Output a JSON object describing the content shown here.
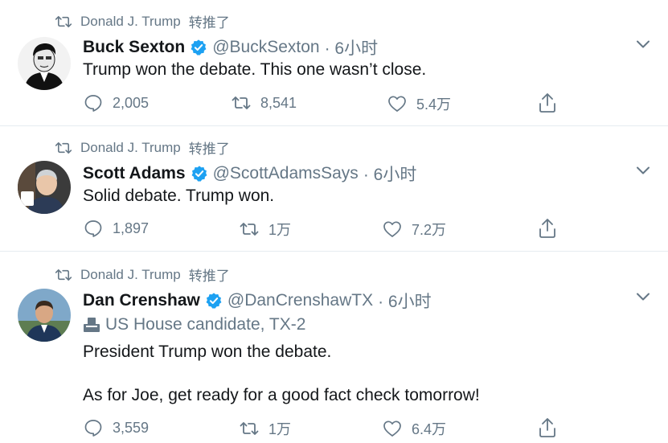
{
  "tweets": [
    {
      "retweeter": "Donald J. Trump",
      "retweet_label": "转推了",
      "name": "Buck Sexton",
      "handle": "@BuckSexton",
      "time": "· 6小时",
      "text": "Trump won the debate. This one wasn’t close.",
      "replies": "2,005",
      "retweets": "8,541",
      "likes": "5.4万"
    },
    {
      "retweeter": "Donald J. Trump",
      "retweet_label": "转推了",
      "name": "Scott Adams",
      "handle": "@ScottAdamsSays",
      "time": "· 6小时",
      "text": "Solid debate. Trump won.",
      "replies": "1,897",
      "retweets": "1万",
      "likes": "7.2万"
    },
    {
      "retweeter": "Donald J. Trump",
      "retweet_label": "转推了",
      "name": "Dan Crenshaw",
      "handle": "@DanCrenshawTX",
      "time": "· 6小时",
      "label": "US House candidate, TX-2",
      "text": "President Trump won the debate.",
      "text2": "As for Joe, get ready for a good fact check tomorrow!",
      "replies": "3,559",
      "retweets": "1万",
      "likes": "6.4万"
    }
  ],
  "colors": {
    "accent": "#1da1f2",
    "secondary": "#657786",
    "text": "#14171a",
    "divider": "#e6ecf0"
  },
  "icons": [
    "retweet-icon",
    "verified-badge-icon",
    "chevron-down-icon",
    "reply-icon",
    "like-icon",
    "share-icon",
    "ballot-box-icon"
  ]
}
